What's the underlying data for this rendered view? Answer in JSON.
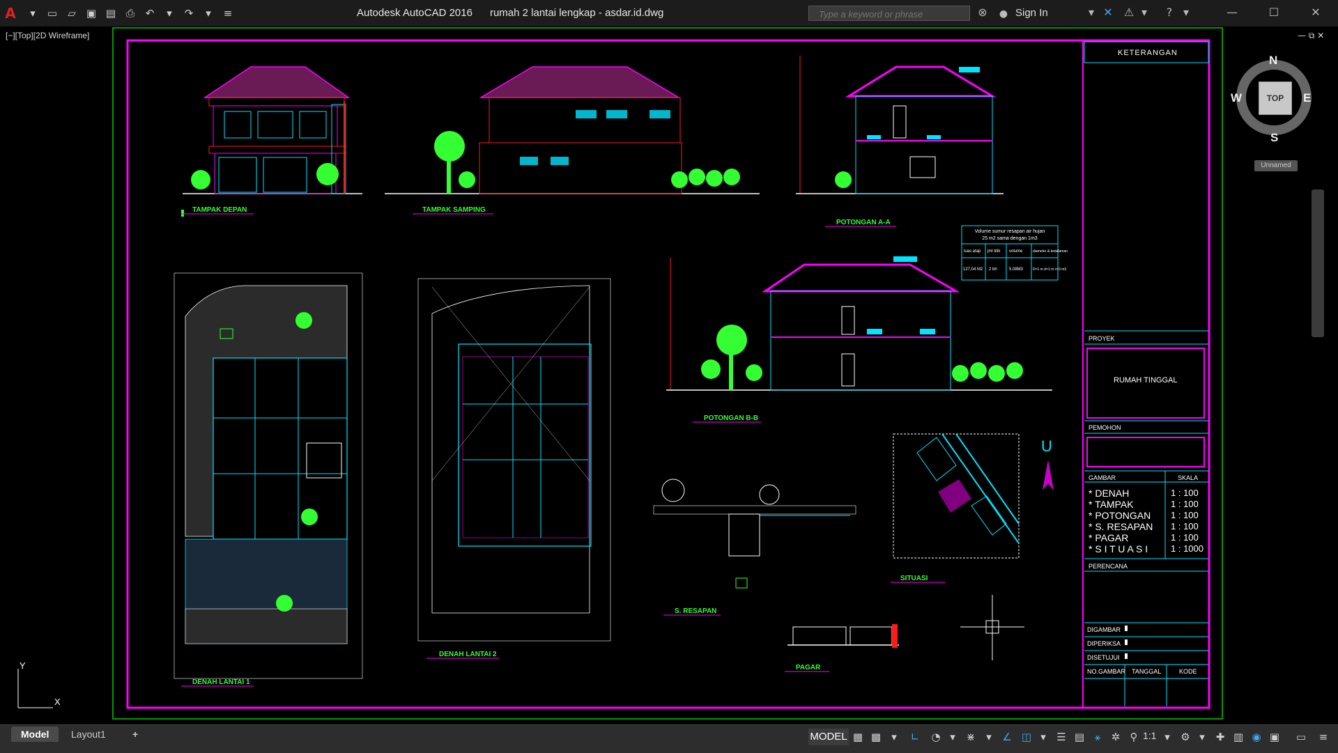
{
  "window": {
    "app_name": "Autodesk AutoCAD 2016",
    "file_name": "rumah 2 lantai lengkap - asdar.id.dwg",
    "search_placeholder": "Type a keyword or phrase",
    "sign_in": "Sign In"
  },
  "viewport": {
    "label": "[−][Top][2D Wireframe]"
  },
  "viewcube": {
    "north": "N",
    "south": "S",
    "east": "E",
    "west": "W",
    "face": "TOP",
    "wcs": "Unnamed"
  },
  "ucs": {
    "x": "X",
    "y": "Y"
  },
  "drawing_labels": {
    "tampak_depan": "TAMPAK DEPAN",
    "tampak_samping": "TAMPAK SAMPING",
    "potongan_aa": "POTONGAN A-A",
    "potongan_bb": "POTONGAN B-B",
    "denah_lantai1": "DENAH LANTAI 1",
    "denah_lantai2": "DENAH LANTAI 2",
    "s_resapan": "S. RESAPAN",
    "situasi": "SITUASI",
    "pagar": "PAGAR",
    "north_arrow": "U"
  },
  "resapan_table": {
    "title_line1": "Volume sumur resapan air hujan",
    "title_line2": "25 m2 sama dengan 1m3",
    "headers": [
      "luas atap",
      "jml titik",
      "volume",
      "diameter & kedalaman"
    ],
    "row": [
      "127,04 M2",
      "2 bh",
      "5.08M3",
      "D=1 m d=1 m v=3 m3"
    ]
  },
  "title_block": {
    "keterangan": "KETERANGAN",
    "proyek_label": "PROYEK",
    "proyek_value": "RUMAH TINGGAL",
    "pemohon_label": "PEMOHON",
    "gambar_label": "GAMBAR",
    "skala_label": "SKALA",
    "items": [
      {
        "name": "* DENAH",
        "scale": "1 : 100"
      },
      {
        "name": "* TAMPAK",
        "scale": "1 : 100"
      },
      {
        "name": "* POTONGAN",
        "scale": "1 : 100"
      },
      {
        "name": "* S. RESAPAN",
        "scale": "1 : 100"
      },
      {
        "name": "* PAGAR",
        "scale": "1 : 100"
      },
      {
        "name": "* S I T U A S I",
        "scale": "1 : 1000"
      }
    ],
    "perencana_label": "PERENCANA",
    "digambar": "DIGAMBAR",
    "diperiksa": "DIPERIKSA",
    "disetujui": "DISETUJUI",
    "no_gambar": "NO.GAMBAR",
    "tanggal": "TANGGAL",
    "kode": "KODE"
  },
  "tabs": {
    "model": "Model",
    "layout1": "Layout1",
    "add": "+"
  },
  "status": {
    "model": "MODEL",
    "scale": "1:1"
  },
  "colors": {
    "frame": "#ff00ff",
    "cyan": "#00e5ff",
    "green": "#33ff33",
    "red": "#ff1a1a",
    "border": "#00cc00",
    "bg": "#000000"
  }
}
